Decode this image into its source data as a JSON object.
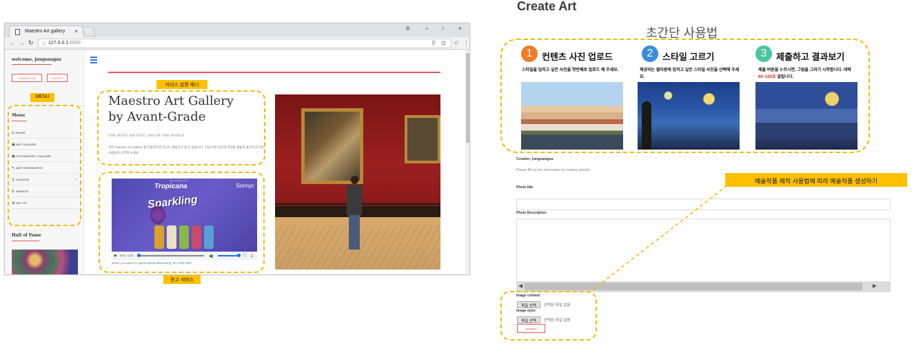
{
  "browser": {
    "tab_title": "Maestro Art gallery",
    "tab_close": "×",
    "url_host": "127.0.0.1",
    "url_port": ":8000",
    "window_controls": [
      "⊪",
      "–",
      "▫",
      "×"
    ]
  },
  "sidebar": {
    "welcome": "welcome, jungsangsu",
    "change_pw": "CHANGE PW",
    "logout": "LOGOUT",
    "menu_title": "Menu",
    "items": [
      {
        "icon": "⌂",
        "label": "HOME"
      },
      {
        "icon": "▣",
        "label": "ART GALLERY"
      },
      {
        "icon": "▣",
        "label": "JUNGSANGSU GALLERY"
      },
      {
        "icon": "✎",
        "label": "ART GENERATION"
      },
      {
        "icon": "⇅",
        "label": "CHANGE"
      },
      {
        "icon": "⚲",
        "label": "SEARCH"
      },
      {
        "icon": "⚙",
        "label": "SET UP"
      }
    ],
    "hall_of_fame": "Hall of Fame"
  },
  "main": {
    "title_line1": "Maestro Art Gallery",
    "title_line2": "by Avant-Grade",
    "subtitle": "THE MOST ARTISTIC SNS IN THE WORLD.",
    "description": "저희 \"Maestro Art Gallery\"를 이용한다면 당신도 예술가가 될 수 있습니다. 지금 바로 당신의 감정을 예술로 표현하고 다른 사람들과 공유해 보세요.",
    "video": {
      "brand": "Tropicana",
      "product": "Sparkling",
      "channel": "Sonnyc",
      "watermark": "www.bandicam.com",
      "time": "0:01 / 1:15"
    },
    "inquire": "When you want to inquire about advertising, 02-1234-4567"
  },
  "annotations": {
    "menu": "MENU",
    "banner": "서비스 설명 배너",
    "ad": "광고 서비스",
    "callout": "예술작품 제작 사용법에 따라 예술작품 생성하기"
  },
  "create": {
    "title": "Create Art",
    "guide_title": "초간단 사용법",
    "steps": [
      {
        "num": "1",
        "title": "컨텐츠 사진 업로드",
        "desc": "스타일을 입히고 싶은 사진을 첫번째로 업로드 해 주세요.",
        "color": "#f07c2a"
      },
      {
        "num": "2",
        "title": "스타일 고르기",
        "desc": "제공되는 필터중에 입히고 싶은 스타일 사진을 선택해 주세요.",
        "color": "#3b8ddc"
      },
      {
        "num": "3",
        "title": "제출하고 결과보기",
        "desc_pre": "제출 버튼을 누르시면, 그림을 그리기 시작합니다. 대략 ",
        "desc_hl": "60~120초",
        "desc_post": " 걸립니다.",
        "color": "#4cc4a2"
      }
    ],
    "creator": "Creator: jungsangsu",
    "note": "Please fill out the information for making artwork",
    "photo_title_label": "Photo title",
    "photo_desc_label": "Photo Description:",
    "image_content_label": "Image content:",
    "image_style_label": "Image style:",
    "file_btn": "파일 선택",
    "file_none": "선택된 파일 없음",
    "submit": "SUBMIT"
  }
}
